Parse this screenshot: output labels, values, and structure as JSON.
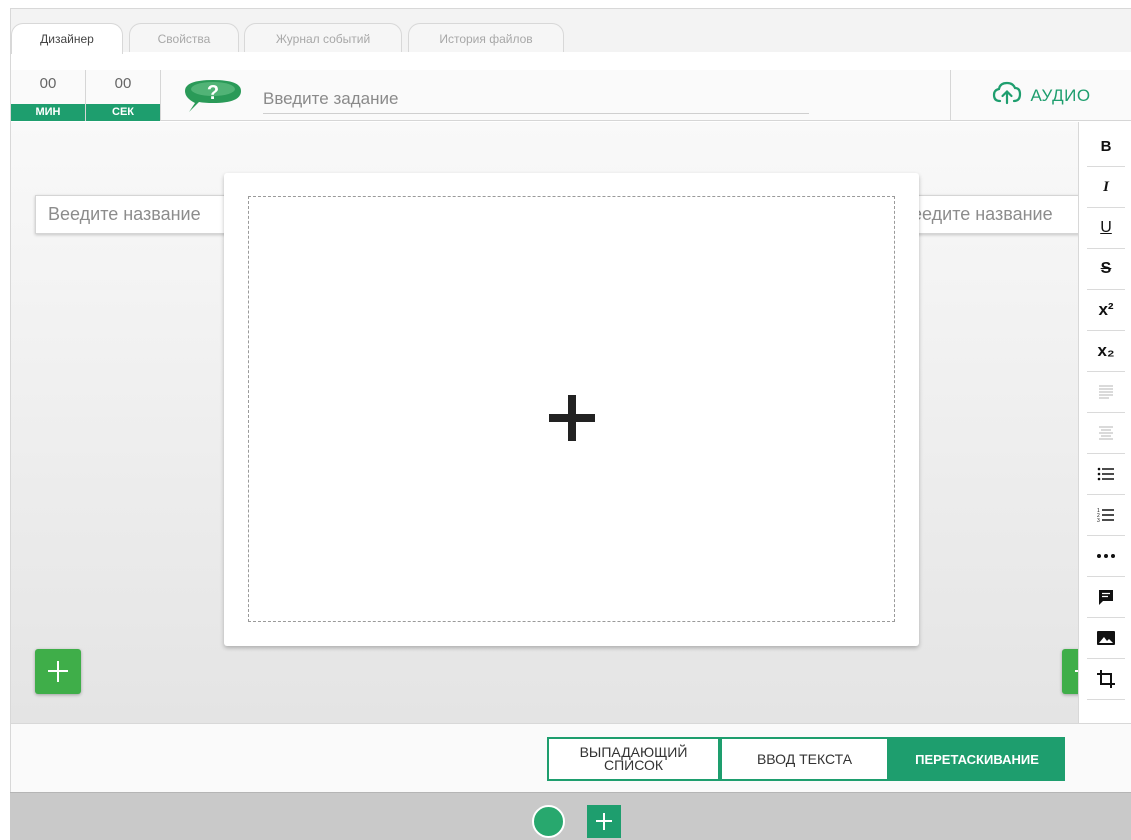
{
  "tabs": [
    {
      "label": "Дизайнер",
      "active": true
    },
    {
      "label": "Свойства",
      "active": false
    },
    {
      "label": "Журнал событий",
      "active": false
    },
    {
      "label": "История файлов",
      "active": false
    }
  ],
  "timer": {
    "minutes": {
      "value": "00",
      "label": "МИН"
    },
    "seconds": {
      "value": "00",
      "label": "СЕК"
    }
  },
  "task": {
    "placeholder": "Введите задание",
    "help_icon": "question-bubble-icon"
  },
  "audio": {
    "label": "АУДИО",
    "icon": "cloud-upload-icon"
  },
  "canvas": {
    "left_name_placeholder": "Веедите название",
    "right_name_placeholder": "Веедите название",
    "add_image_icon": "plus-icon"
  },
  "toolbar": [
    {
      "name": "bold",
      "label": "B"
    },
    {
      "name": "italic",
      "label": "I"
    },
    {
      "name": "underline",
      "label": "U"
    },
    {
      "name": "strikethrough",
      "label": "S"
    },
    {
      "name": "superscript",
      "label": "x²"
    },
    {
      "name": "subscript",
      "label": "x₂"
    },
    {
      "name": "align-left",
      "icon": "align-left-icon",
      "disabled": true
    },
    {
      "name": "align-center",
      "icon": "align-center-icon",
      "disabled": true
    },
    {
      "name": "bulleted-list",
      "icon": "bulleted-list-icon"
    },
    {
      "name": "numbered-list",
      "icon": "numbered-list-icon"
    },
    {
      "name": "more",
      "icon": "more-dots-icon"
    },
    {
      "name": "comment",
      "icon": "comment-icon"
    },
    {
      "name": "image",
      "icon": "image-icon"
    },
    {
      "name": "crop",
      "icon": "crop-icon"
    }
  ],
  "modes": {
    "dropdown": "ВЫПАДАЮЩИЙ СПИСОК",
    "text_input": "ВВОД ТЕКСТА",
    "drag_drop": "ПЕРЕТАСКИВАНИЕ",
    "active": "drag_drop"
  },
  "colors": {
    "accent": "#1e9e6e",
    "add_button": "#3fae49"
  }
}
